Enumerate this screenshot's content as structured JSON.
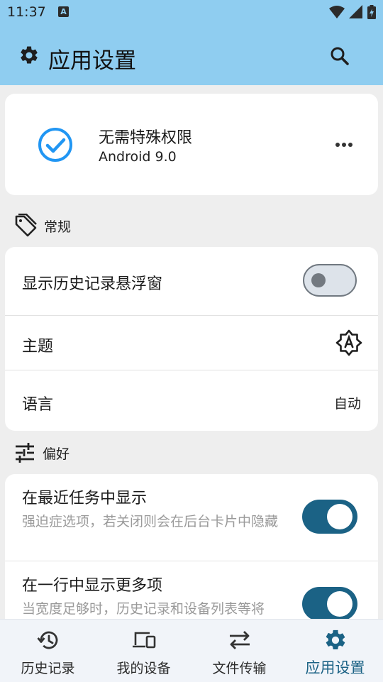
{
  "status_bar": {
    "time": "11:37",
    "notif_letter": "A"
  },
  "app_bar": {
    "title": "应用设置"
  },
  "info_card": {
    "title": "无需特殊权限",
    "subtitle": "Android 9.0"
  },
  "sections": {
    "general": {
      "label": "常规"
    },
    "preferences": {
      "label": "偏好"
    }
  },
  "general_rows": {
    "history_window": {
      "label": "显示历史记录悬浮窗",
      "enabled": false
    },
    "theme": {
      "label": "主题"
    },
    "language": {
      "label": "语言",
      "value": "自动"
    }
  },
  "pref_rows": {
    "recent_tasks": {
      "label": "在最近任务中显示",
      "description": "强迫症选项，若关闭则会在后台卡片中隐藏",
      "enabled": true
    },
    "more_items": {
      "label": "在一行中显示更多项",
      "description": "当宽度足够时，历史记录和设备列表等将",
      "enabled": true
    }
  },
  "bottom_nav": {
    "items": [
      {
        "label": "历史记录",
        "icon": "history-icon"
      },
      {
        "label": "我的设备",
        "icon": "devices-icon"
      },
      {
        "label": "文件传输",
        "icon": "swap-icon"
      },
      {
        "label": "应用设置",
        "icon": "gear-icon"
      }
    ],
    "active_index": 3
  },
  "colors": {
    "app_bar": "#8fcdf0",
    "accent": "#1b6285",
    "check": "#2196f3"
  }
}
